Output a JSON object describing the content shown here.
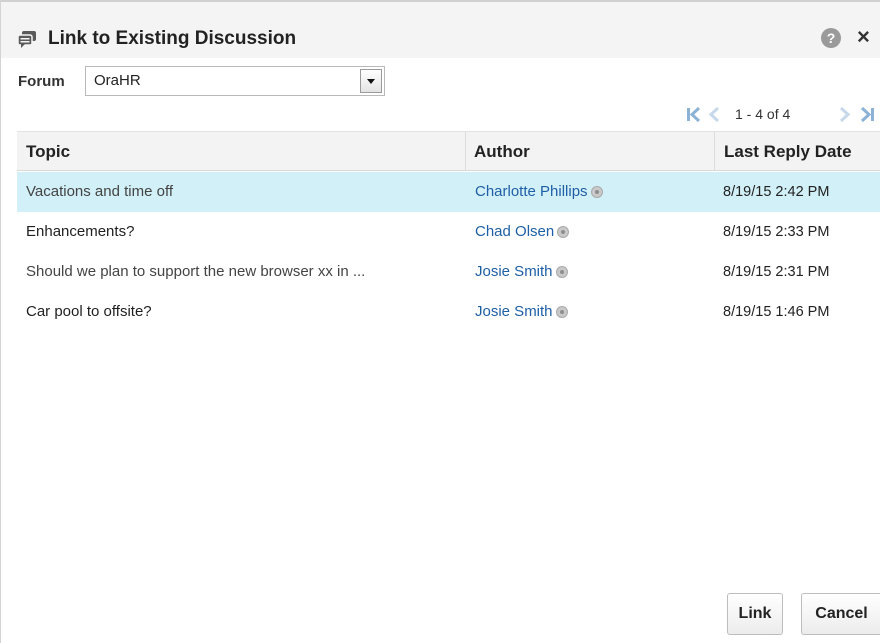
{
  "dialog": {
    "title": "Link to Existing Discussion",
    "icon": "discussion-icon",
    "help_icon": "help-icon",
    "help_glyph": "?",
    "close_icon": "close-icon",
    "close_glyph": "×"
  },
  "forum": {
    "label": "Forum",
    "selected": "OraHR"
  },
  "pager": {
    "first_glyph": "|<",
    "prev_glyph": "<",
    "range_text": "1 - 4 of 4",
    "next_glyph": ">",
    "last_glyph": ">|"
  },
  "table": {
    "columns": [
      "Topic",
      "Author",
      "Last Reply Date"
    ],
    "rows": [
      {
        "topic": "Vacations and time off",
        "author": "Charlotte Phillips",
        "date": "8/19/15 2:42 PM"
      },
      {
        "topic": "Enhancements?",
        "author": "Chad Olsen",
        "date": "8/19/15 2:33 PM"
      },
      {
        "topic": "Should we plan to support the new browser xx in ...",
        "author": "Josie Smith",
        "date": "8/19/15 2:31 PM"
      },
      {
        "topic": "Car pool to offsite?",
        "author": "Josie Smith",
        "date": "8/19/15 1:46 PM"
      }
    ],
    "selected_row": 0
  },
  "buttons": {
    "link_label": "Link",
    "cancel_label": "Cancel"
  },
  "colors": {
    "selected_row": "#d2f0f7",
    "author_link": "#1f5fa6",
    "pager_arrow": "#8cb2d6"
  }
}
